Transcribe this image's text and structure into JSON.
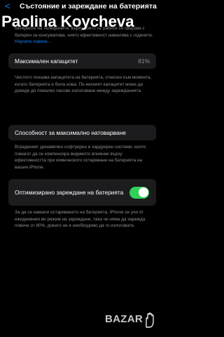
{
  "nav": {
    "back_label": "<",
    "title": "Състояние и зареждане на батерията"
  },
  "watermark": {
    "text": "Paolina Koycheva"
  },
  "intro": {
    "text": "батериите на телефоните, върху които се работи се свързва с батерии за консуматива, чиято ефективност намалява с годините.",
    "link": "Научете повече..."
  },
  "capacity": {
    "label": "Максимален капацитет",
    "value": "81%"
  },
  "capacity_desc": "Числото показва капацитета на батерията, отнесен към момента, когато батерията е била нова. По-ниският капацитет може да доведе до помалко часове използване между зарежданията.",
  "peak": {
    "label": "Способност за максимално натоварване"
  },
  "peak_desc": "Вграденият динамичен софтуерен и хардуерен системи, които помагат да се компенсира видимото влияние върху ефективността при химическото остаряване на батерията на вашия iPhone.",
  "optimized": {
    "label": "Оптимизирано зареждане на батерията",
    "enabled": true
  },
  "optimized_desc": "За да се намали остаряването на батерията, iPhone се учи от ежедневния ви режим на зареждане, така че няма да зарежда повече от 80%, докато не е необходимо да го използвате.",
  "bazar_logo": {
    "text": "BAZAR"
  },
  "colors": {
    "accent": "#0a84ff",
    "toggle_on": "#30d158",
    "card": "#1c1c1e",
    "secondary_text": "#8e8e93"
  }
}
